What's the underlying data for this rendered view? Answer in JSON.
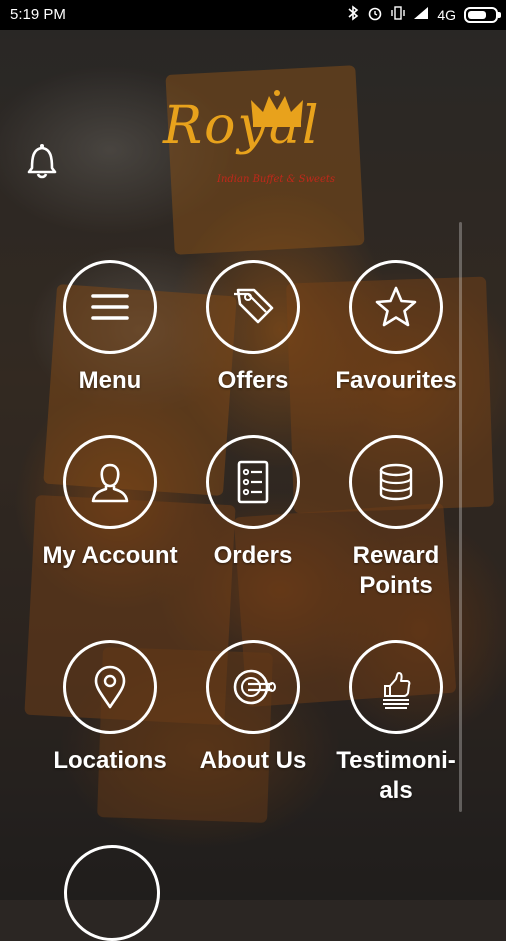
{
  "status_bar": {
    "time": "5:19 PM",
    "network": "4G"
  },
  "brand": {
    "name": "Royal",
    "tagline": "Indian Buffet & Sweets"
  },
  "menu_items": [
    {
      "label": "Menu",
      "icon": "menu-lines-icon"
    },
    {
      "label": "Offers",
      "icon": "price-tag-icon"
    },
    {
      "label": "Favourites",
      "icon": "star-icon"
    },
    {
      "label": "My Account",
      "icon": "user-silhouette-icon"
    },
    {
      "label": "Orders",
      "icon": "checklist-icon"
    },
    {
      "label": "Reward Points",
      "icon": "coin-stack-icon"
    },
    {
      "label": "Locations",
      "icon": "map-pin-icon"
    },
    {
      "label": "About Us",
      "icon": "plate-cutlery-icon"
    },
    {
      "label": "Testimoni-als",
      "icon": "thumbs-up-review-icon"
    }
  ],
  "colors": {
    "brand_gold": "#e8a21c",
    "tagline_red": "#c0281a",
    "status_bar": "#000000"
  }
}
